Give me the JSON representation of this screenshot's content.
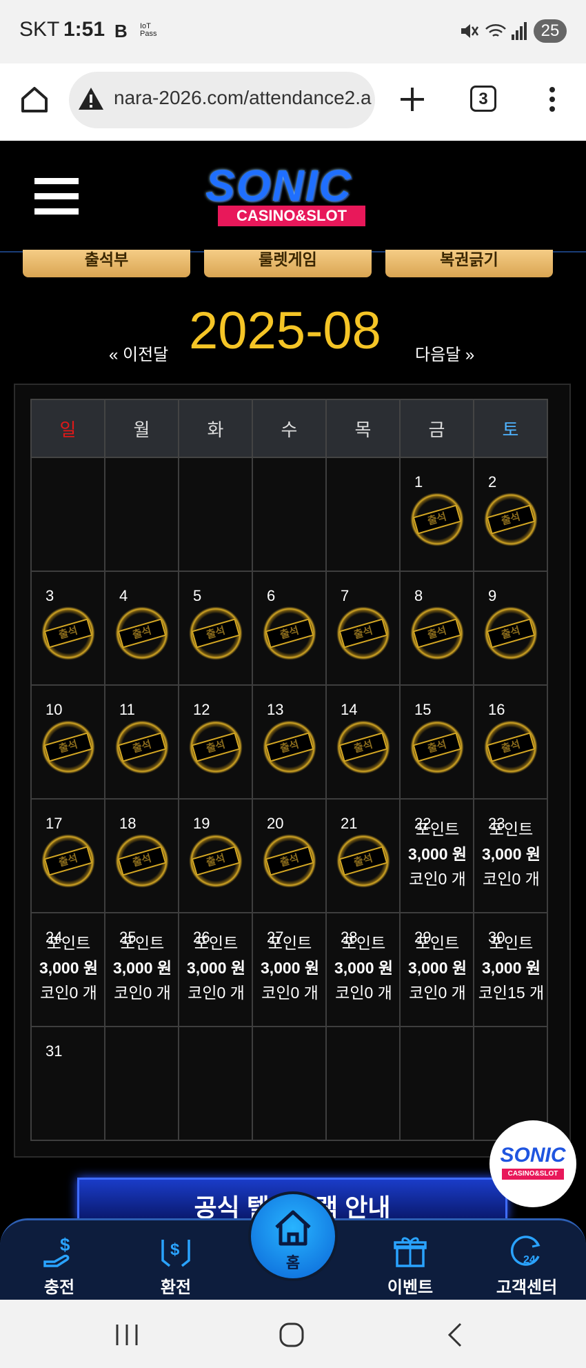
{
  "status": {
    "carrier": "SKT",
    "time": "1:51",
    "iot": "IoT Pass",
    "battery": "25"
  },
  "browser": {
    "url": "nara-2026.com/attendance2.a",
    "tabs": "3"
  },
  "site": {
    "logo_top": "SONIC",
    "logo_bottom": "CASINO&SLOT"
  },
  "nav": [
    "출석부",
    "룰렛게임",
    "복권긁기"
  ],
  "month": {
    "prev": "« 이전달",
    "title": "2025-08",
    "next": "다음달 »"
  },
  "weekdays": [
    "일",
    "월",
    "화",
    "수",
    "목",
    "금",
    "토"
  ],
  "stamp_label": "출석",
  "days": [
    {
      "d": "1",
      "k": "s"
    },
    {
      "d": "2",
      "k": "s"
    },
    {
      "d": "3",
      "k": "s"
    },
    {
      "d": "4",
      "k": "s"
    },
    {
      "d": "5",
      "k": "s"
    },
    {
      "d": "6",
      "k": "s"
    },
    {
      "d": "7",
      "k": "s"
    },
    {
      "d": "8",
      "k": "s"
    },
    {
      "d": "9",
      "k": "s"
    },
    {
      "d": "10",
      "k": "s"
    },
    {
      "d": "11",
      "k": "s"
    },
    {
      "d": "12",
      "k": "s"
    },
    {
      "d": "13",
      "k": "s"
    },
    {
      "d": "14",
      "k": "s"
    },
    {
      "d": "15",
      "k": "s"
    },
    {
      "d": "16",
      "k": "s"
    },
    {
      "d": "17",
      "k": "s"
    },
    {
      "d": "18",
      "k": "s"
    },
    {
      "d": "19",
      "k": "s"
    },
    {
      "d": "20",
      "k": "s"
    },
    {
      "d": "21",
      "k": "s"
    },
    {
      "d": "22",
      "k": "r",
      "p": "포인트",
      "a": "3,000 원",
      "c": "코인0 개"
    },
    {
      "d": "23",
      "k": "r",
      "p": "포인트",
      "a": "3,000 원",
      "c": "코인0 개"
    },
    {
      "d": "24",
      "k": "r",
      "p": "포인트",
      "a": "3,000 원",
      "c": "코인0 개"
    },
    {
      "d": "25",
      "k": "r",
      "p": "포인트",
      "a": "3,000 원",
      "c": "코인0 개"
    },
    {
      "d": "26",
      "k": "r",
      "p": "포인트",
      "a": "3,000 원",
      "c": "코인0 개"
    },
    {
      "d": "27",
      "k": "r",
      "p": "포인트",
      "a": "3,000 원",
      "c": "코인0 개"
    },
    {
      "d": "28",
      "k": "r",
      "p": "포인트",
      "a": "3,000 원",
      "c": "코인0 개"
    },
    {
      "d": "29",
      "k": "r",
      "p": "포인트",
      "a": "3,000 원",
      "c": "코인0 개"
    },
    {
      "d": "30",
      "k": "r",
      "p": "포인트",
      "a": "3,000 원",
      "c": "코인15 개"
    },
    {
      "d": "31",
      "k": "n"
    }
  ],
  "banner": "공식 텔레그램 안내",
  "bottomnav": {
    "charge": "충전",
    "exchange": "환전",
    "home": "홈",
    "event": "이벤트",
    "support": "고객센터"
  }
}
